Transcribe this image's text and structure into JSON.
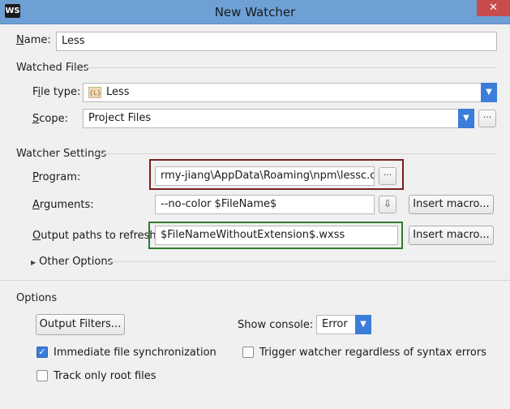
{
  "window": {
    "title": "New Watcher",
    "app_logo": "WS",
    "close_glyph": "✕"
  },
  "name": {
    "label": "Name:",
    "value": "Less"
  },
  "watched_files": {
    "section": "Watched Files",
    "file_type_label": "File type:",
    "file_type_value": "Less",
    "file_type_icon": "{L}",
    "scope_label": "Scope:",
    "scope_value": "Project Files"
  },
  "watcher_settings": {
    "section": "Watcher Settings",
    "program_label": "Program:",
    "program_value": "rmy-jiang\\AppData\\Roaming\\npm\\lessc.cmd",
    "arguments_label": "Arguments:",
    "arguments_value": "--no-color $FileName$",
    "output_label": "Output paths to refresh:",
    "output_value": "$FileNameWithoutExtension$.wxss",
    "insert_macro_label": "Insert macro...",
    "other_options_label": "Other Options"
  },
  "options": {
    "section": "Options",
    "output_filters_label": "Output Filters...",
    "show_console_label": "Show console:",
    "show_console_value": "Error",
    "immediate_sync_label": "Immediate file synchronization",
    "immediate_sync_checked": true,
    "trigger_watcher_label": "Trigger watcher regardless of syntax errors",
    "trigger_watcher_checked": false,
    "track_root_label": "Track only root files",
    "track_root_checked": false
  },
  "highlights": {
    "program_box": "#7a1f1f",
    "output_box": "#2f7a2f"
  }
}
